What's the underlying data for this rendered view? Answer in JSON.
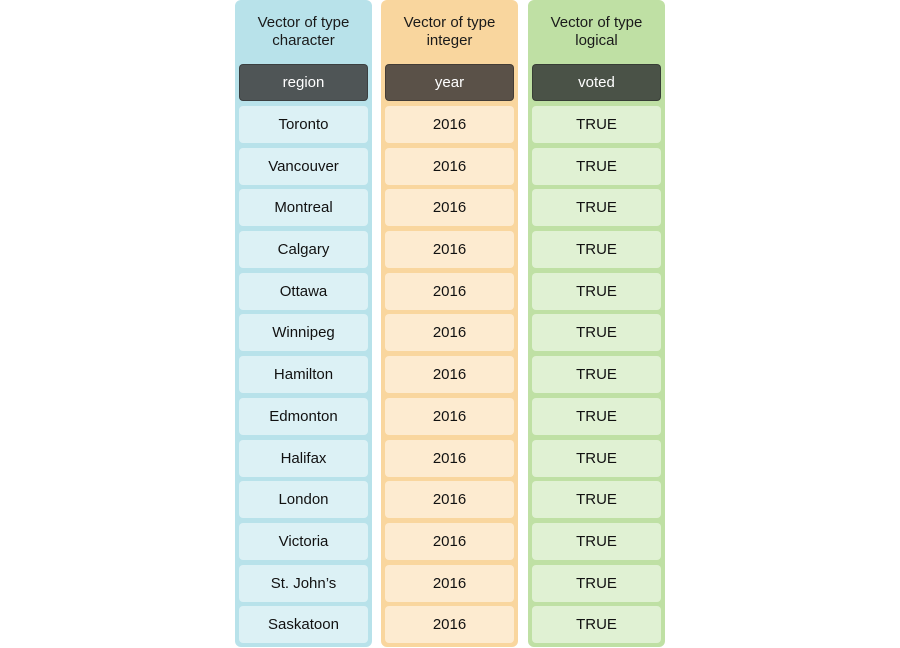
{
  "columns": [
    {
      "title": "Vector of type\ncharacter",
      "title_line1": "Vector of type",
      "title_line2": "character",
      "header": "region",
      "color": "#b8e2ea",
      "values": [
        "Toronto",
        "Vancouver",
        "Montreal",
        "Calgary",
        "Ottawa",
        "Winnipeg",
        "Hamilton",
        "Edmonton",
        "Halifax",
        "London",
        "Victoria",
        "St. John’s",
        "Saskatoon"
      ]
    },
    {
      "title_line1": "Vector of type",
      "title_line2": "integer",
      "header": "year",
      "color": "#f9d69e",
      "values": [
        "2016",
        "2016",
        "2016",
        "2016",
        "2016",
        "2016",
        "2016",
        "2016",
        "2016",
        "2016",
        "2016",
        "2016",
        "2016"
      ]
    },
    {
      "title_line1": "Vector of type",
      "title_line2": "logical",
      "header": "voted",
      "color": "#bfe0a4",
      "values": [
        "TRUE",
        "TRUE",
        "TRUE",
        "TRUE",
        "TRUE",
        "TRUE",
        "TRUE",
        "TRUE",
        "TRUE",
        "TRUE",
        "TRUE",
        "TRUE",
        "TRUE"
      ]
    }
  ]
}
